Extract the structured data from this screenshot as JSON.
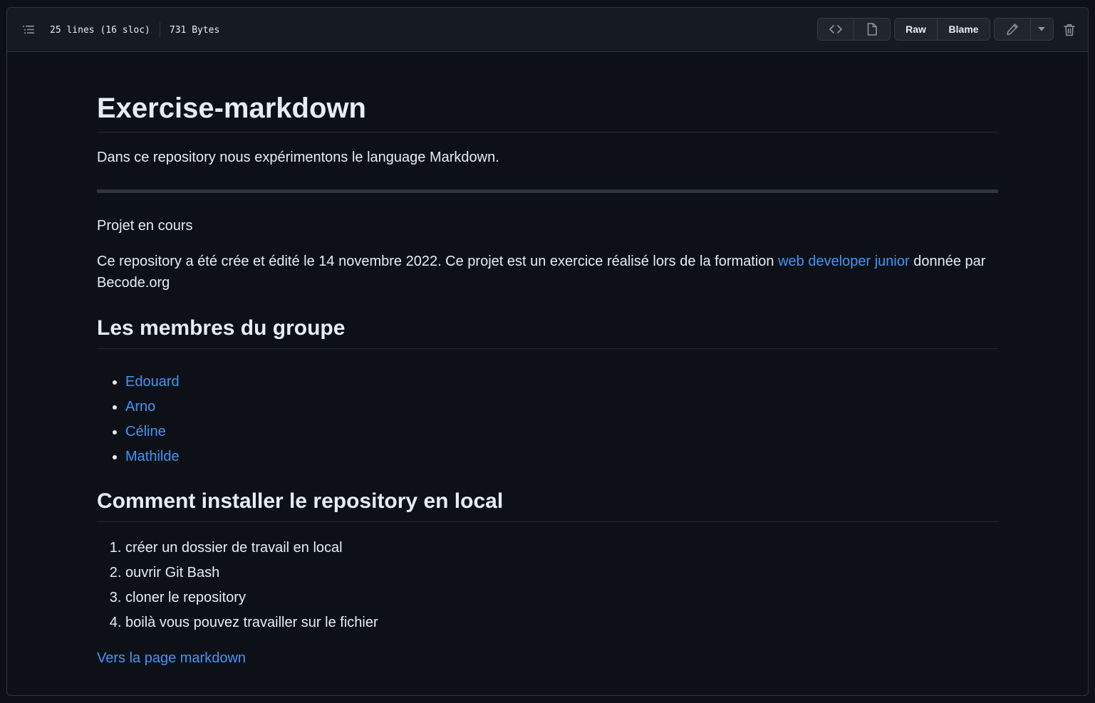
{
  "header": {
    "lines": "25 lines (16 sloc)",
    "size": "731 Bytes",
    "raw_label": "Raw",
    "blame_label": "Blame"
  },
  "readme": {
    "title": "Exercise-markdown",
    "intro": "Dans ce repository nous expérimentons le language Markdown.",
    "status": "Projet en cours",
    "desc_before": "Ce repository a été crée et édité le 14 novembre 2022. Ce projet est un exercice réalisé lors de la formation ",
    "desc_link": "web developer junior",
    "desc_after": " donnée par Becode.org",
    "members_heading": "Les membres du groupe",
    "members": [
      "Edouard",
      "Arno",
      "Céline",
      "Mathilde"
    ],
    "install_heading": "Comment installer le repository en local",
    "steps": [
      "créer un dossier de travail en local",
      "ouvrir Git Bash",
      "cloner le repository",
      "boilà vous pouvez travailler sur le fichier"
    ],
    "footer_link": "Vers la page markdown"
  },
  "colors": {
    "background": "#0d1117",
    "header": "#161b22",
    "border": "#30363d",
    "link": "#4493f8",
    "text": "#e6edf3"
  }
}
